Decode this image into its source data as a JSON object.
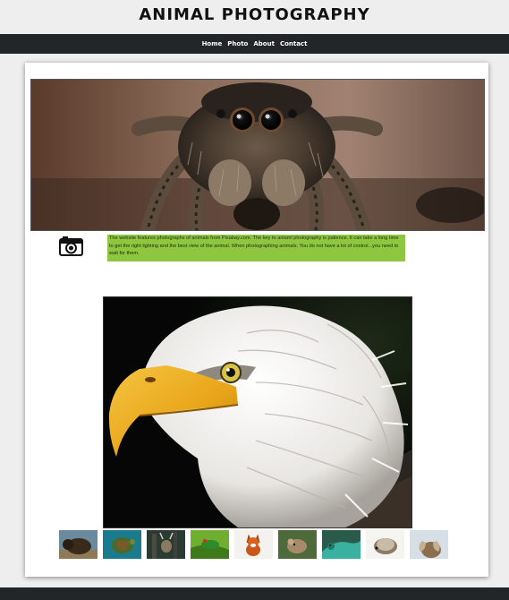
{
  "site": {
    "title": "ANIMAL PHOTOGRAPHY"
  },
  "nav": {
    "items": [
      "Home",
      "Photo",
      "About",
      "Contact"
    ]
  },
  "intro": {
    "text": "The website features photographs of animals from Pixabay.com. The key to aniaml photography is patience. It can take a long time to get the right lighting and the best view of the animal. When photographing animals. You do not have a lot of control...you need to wait for them."
  },
  "colors": {
    "nav": "#222628",
    "highlight": "#8ec63f"
  },
  "icons": {
    "camera": "camera-icon"
  },
  "thumbnails": [
    "bison",
    "turtle",
    "deer",
    "frog",
    "fox",
    "mouse",
    "lizard",
    "hedgehog",
    "ram"
  ]
}
